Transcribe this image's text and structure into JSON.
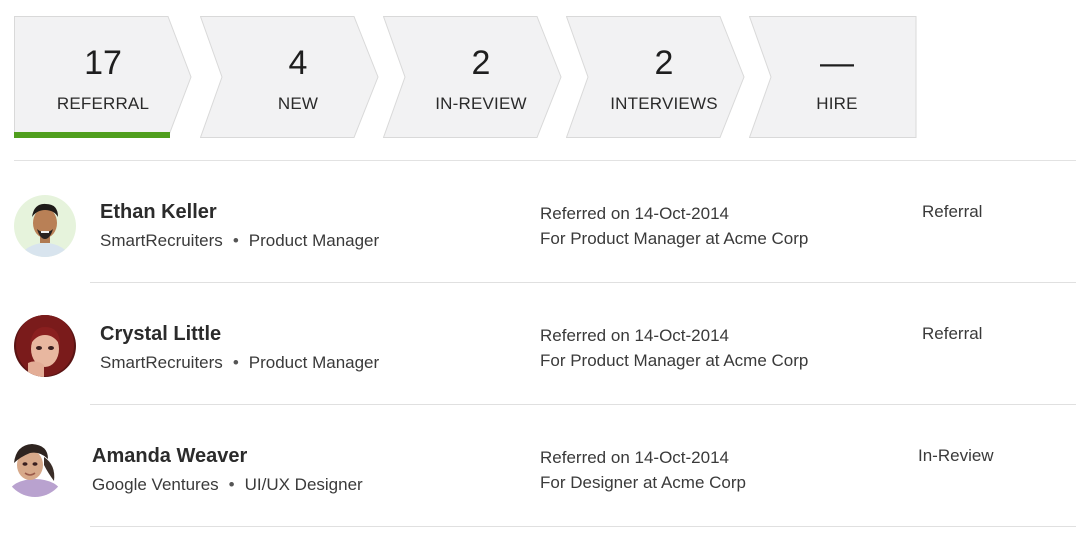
{
  "pipeline": {
    "stages": [
      {
        "count": "17",
        "label": "REFERRAL",
        "active": true
      },
      {
        "count": "4",
        "label": "NEW",
        "active": false
      },
      {
        "count": "2",
        "label": "IN-REVIEW",
        "active": false
      },
      {
        "count": "2",
        "label": "INTERVIEWS",
        "active": false
      },
      {
        "count": "—",
        "label": "HIRE",
        "active": false
      }
    ],
    "active_color": "#4f9e1d",
    "stage_fill": "#f2f2f3",
    "stage_border": "#d9d9d9"
  },
  "candidates": [
    {
      "name": "Ethan Keller",
      "company": "SmartRecruiters",
      "title": "Product Manager",
      "referred": "Referred on 14-Oct-2014",
      "for": "For Product Manager at Acme Corp",
      "status": "Referral"
    },
    {
      "name": "Crystal Little",
      "company": "SmartRecruiters",
      "title": "Product Manager",
      "referred": "Referred on 14-Oct-2014",
      "for": "For Product Manager at Acme Corp",
      "status": "Referral"
    },
    {
      "name": "Amanda Weaver",
      "company": "Google Ventures",
      "title": "UI/UX Designer",
      "referred": "Referred on 14-Oct-2014",
      "for": "For Designer at Acme Corp",
      "status": "In-Review"
    }
  ]
}
